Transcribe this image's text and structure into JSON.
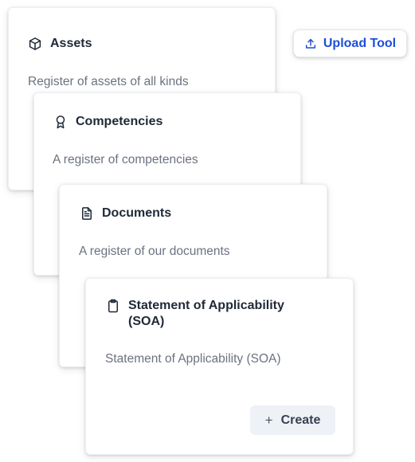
{
  "toolbar": {
    "upload_label": "Upload Tool",
    "upload_icon": "upload-icon"
  },
  "cards": [
    {
      "title": "Assets",
      "description": "Register of assets of all kinds",
      "icon": "cube-icon"
    },
    {
      "title": "Competencies",
      "description": "A register of competencies",
      "icon": "award-icon"
    },
    {
      "title": "Documents",
      "description": "A register of our documents",
      "icon": "document-icon"
    },
    {
      "title": "Statement of Applicability (SOA)",
      "description": "Statement of Applicability (SOA)",
      "icon": "clipboard-icon",
      "action_label": "Create",
      "action_icon": "plus-icon"
    }
  ],
  "colors": {
    "accent": "#1d4ed8",
    "text": "#1f2937",
    "muted": "#6b7280",
    "button_bg": "#eef1f6"
  }
}
